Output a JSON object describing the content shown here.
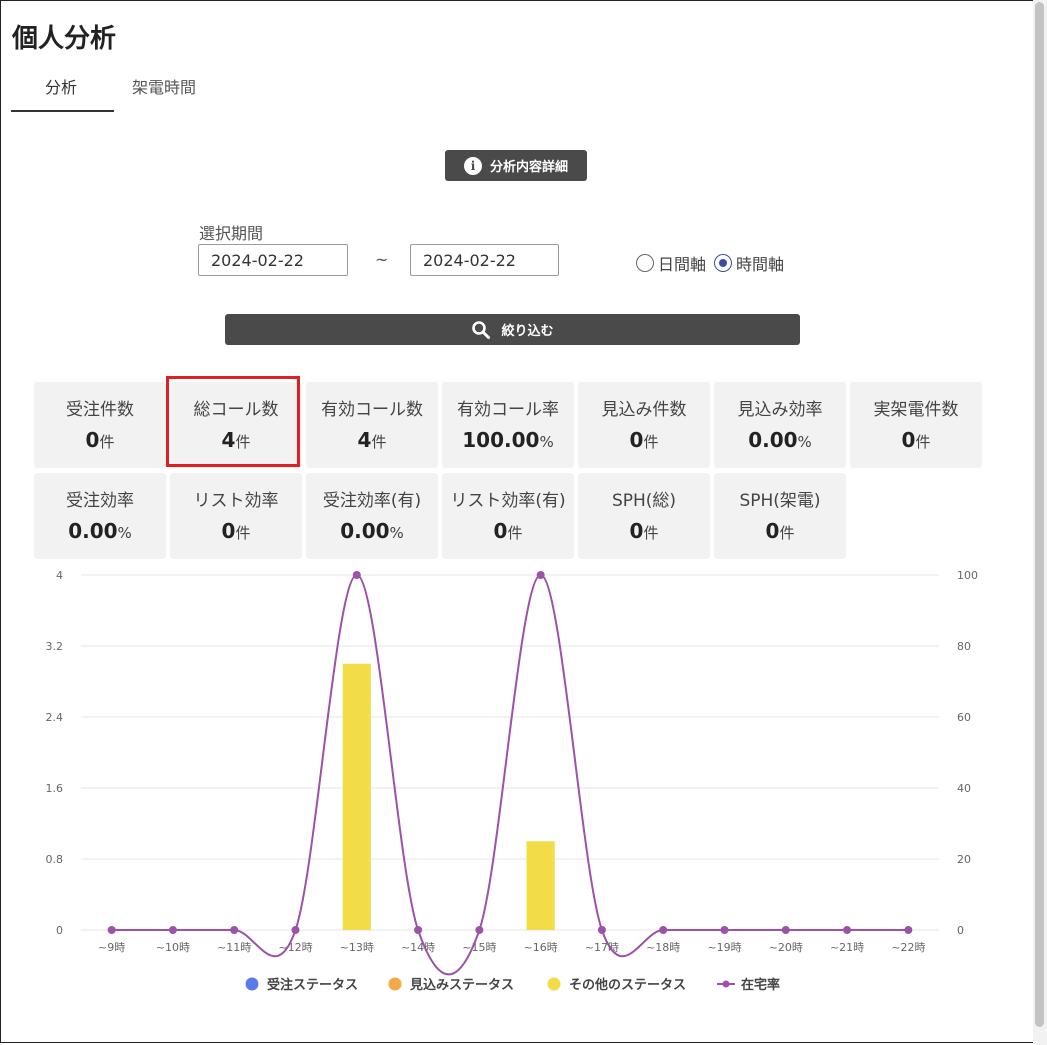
{
  "page_title": "個人分析",
  "tabs": [
    {
      "label": "分析",
      "active": true
    },
    {
      "label": "架電時間",
      "active": false
    }
  ],
  "detail_button": {
    "label": "分析内容詳細",
    "icon": "info-icon"
  },
  "filters": {
    "period_label": "選択期間",
    "start_date": "2024-02-22",
    "separator": "~",
    "end_date": "2024-02-22",
    "axis_options": [
      {
        "label": "日間軸",
        "selected": false
      },
      {
        "label": "時間軸",
        "selected": true
      }
    ],
    "filter_button": {
      "label": "絞り込む",
      "icon": "search-icon"
    }
  },
  "stats": [
    {
      "label": "受注件数",
      "value": "0",
      "unit": "件"
    },
    {
      "label": "総コール数",
      "value": "4",
      "unit": "件",
      "highlighted": true
    },
    {
      "label": "有効コール数",
      "value": "4",
      "unit": "件"
    },
    {
      "label": "有効コール率",
      "value": "100.00",
      "unit": "%"
    },
    {
      "label": "見込み件数",
      "value": "0",
      "unit": "件"
    },
    {
      "label": "見込み効率",
      "value": "0.00",
      "unit": "%"
    },
    {
      "label": "実架電件数",
      "value": "0",
      "unit": "件"
    },
    {
      "label": "受注効率",
      "value": "0.00",
      "unit": "%"
    },
    {
      "label": "リスト効率",
      "value": "0",
      "unit": "件"
    },
    {
      "label": "受注効率(有)",
      "value": "0.00",
      "unit": "%"
    },
    {
      "label": "リスト効率(有)",
      "value": "0",
      "unit": "件"
    },
    {
      "label": "SPH(総)",
      "value": "0",
      "unit": "件"
    },
    {
      "label": "SPH(架電)",
      "value": "0",
      "unit": "件"
    }
  ],
  "colors": {
    "highlight": "#e02020",
    "button_bg": "#4a4a4a",
    "radio_accent": "#3b4fa0",
    "order_status": "#5b7be8",
    "prospect_status": "#f3a945",
    "other_status": "#f2dc48",
    "home_rate": "#9c52a8"
  },
  "chart_data": {
    "type": "bar",
    "categories": [
      "~9時",
      "~10時",
      "~11時",
      "~12時",
      "~13時",
      "~14時",
      "~15時",
      "~16時",
      "~17時",
      "~18時",
      "~19時",
      "~20時",
      "~21時",
      "~22時"
    ],
    "y_left_ticks": [
      "0",
      "0.8",
      "1.6",
      "2.4",
      "3.2",
      "4"
    ],
    "y_right_ticks": [
      "0",
      "20",
      "40",
      "60",
      "80",
      "100"
    ],
    "ylim_left": [
      0,
      4
    ],
    "ylim_right": [
      0,
      100
    ],
    "series": [
      {
        "name": "受注ステータス",
        "kind": "bar",
        "values": [
          0,
          0,
          0,
          0,
          0,
          0,
          0,
          0,
          0,
          0,
          0,
          0,
          0,
          0
        ]
      },
      {
        "name": "見込みステータス",
        "kind": "bar",
        "values": [
          0,
          0,
          0,
          0,
          0,
          0,
          0,
          0,
          0,
          0,
          0,
          0,
          0,
          0
        ]
      },
      {
        "name": "その他のステータス",
        "kind": "bar",
        "values": [
          0,
          0,
          0,
          0,
          3,
          0,
          0,
          1,
          0,
          0,
          0,
          0,
          0,
          0
        ]
      },
      {
        "name": "在宅率",
        "kind": "line",
        "axis": "right",
        "values": [
          0,
          0,
          0,
          0,
          100,
          0,
          0,
          100,
          0,
          0,
          0,
          0,
          0,
          0
        ]
      }
    ],
    "grid": true,
    "legend_position": "bottom"
  }
}
